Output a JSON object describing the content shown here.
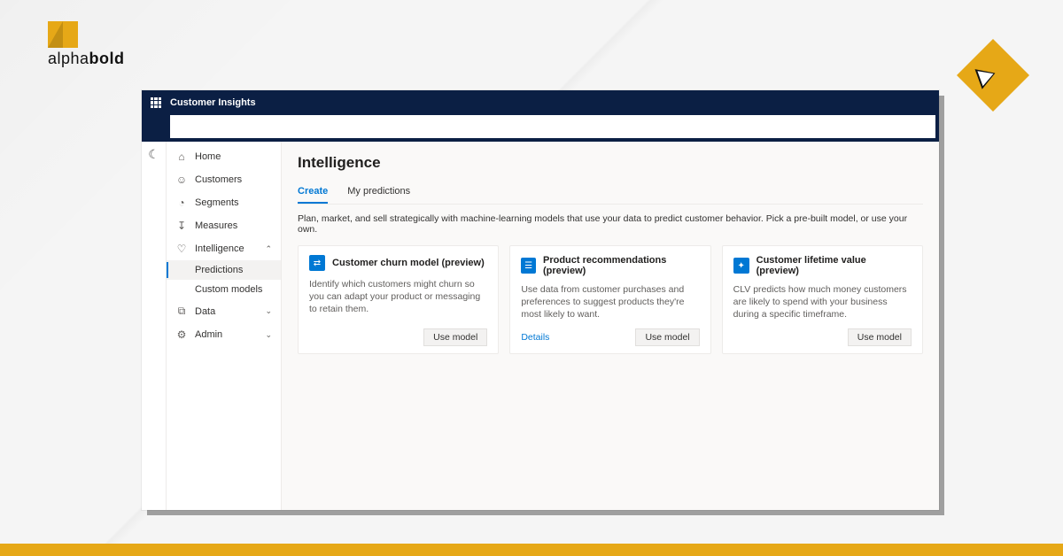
{
  "brand": {
    "word_light": "alpha",
    "word_bold": "bold"
  },
  "app": {
    "title": "Customer Insights",
    "search_placeholder": ""
  },
  "sidebar": {
    "items": [
      {
        "icon": "⌂",
        "label": "Home"
      },
      {
        "icon": "☺",
        "label": "Customers"
      },
      {
        "icon": "◔",
        "label": "Segments"
      },
      {
        "icon": "↧",
        "label": "Measures"
      },
      {
        "icon": "♡",
        "label": "Intelligence",
        "expandable": true,
        "chev": "⌃"
      },
      {
        "icon": "",
        "label": "Predictions",
        "sub": true,
        "active": true
      },
      {
        "icon": "",
        "label": "Custom models",
        "sub": true
      },
      {
        "icon": "⧉",
        "label": "Data",
        "expandable": true,
        "chev": "⌄"
      },
      {
        "icon": "⚙",
        "label": "Admin",
        "expandable": true,
        "chev": "⌄"
      }
    ]
  },
  "main": {
    "title": "Intelligence",
    "tabs": [
      {
        "label": "Create",
        "active": true
      },
      {
        "label": "My predictions"
      }
    ],
    "description": "Plan, market, and sell strategically with machine-learning models that use your data to predict customer behavior. Pick a pre-built model, or use your own.",
    "cards": [
      {
        "icon": "⇄",
        "title": "Customer churn model (preview)",
        "body": "Identify which customers might churn so you can adapt your product or messaging to retain them.",
        "details": null,
        "button": "Use model"
      },
      {
        "icon": "☰",
        "title": "Product recommendations (preview)",
        "body": "Use data from customer purchases and preferences to suggest products they're most likely to want.",
        "details": "Details",
        "button": "Use model"
      },
      {
        "icon": "✦",
        "title": "Customer lifetime value (preview)",
        "body": "CLV predicts how much money customers are likely to spend with your business during a specific timeframe.",
        "details": null,
        "button": "Use model"
      }
    ]
  }
}
